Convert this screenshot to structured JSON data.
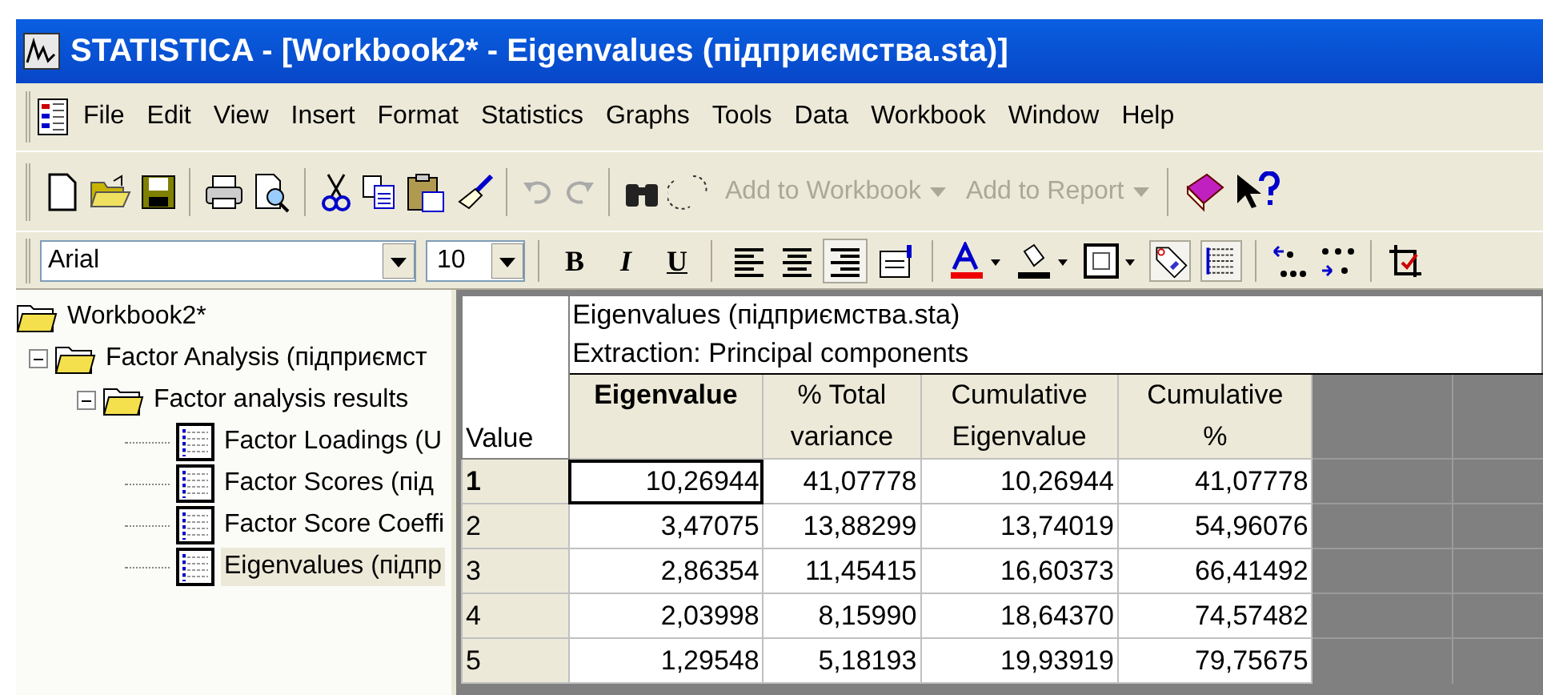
{
  "window": {
    "title": "STATISTICA - [Workbook2* - Eigenvalues (підприємства.sta)]"
  },
  "menu": [
    {
      "label": "File"
    },
    {
      "label": "Edit"
    },
    {
      "label": "View"
    },
    {
      "label": "Insert"
    },
    {
      "label": "Format"
    },
    {
      "label": "Statistics"
    },
    {
      "label": "Graphs"
    },
    {
      "label": "Tools"
    },
    {
      "label": "Data"
    },
    {
      "label": "Workbook"
    },
    {
      "label": "Window"
    },
    {
      "label": "Help"
    }
  ],
  "toolbar": {
    "text_buttons": [
      {
        "label": "Add to Workbook",
        "disabled": true
      },
      {
        "label": "Add to Report",
        "disabled": true
      }
    ]
  },
  "format_toolbar": {
    "font": "Arial",
    "size": "10",
    "style_buttons": [
      "B",
      "I",
      "U"
    ],
    "align_buttons": [
      {
        "selected": false
      },
      {
        "selected": false
      },
      {
        "selected": true
      }
    ]
  },
  "tree": [
    {
      "label": "Workbook2*",
      "selected": false,
      "children": [
        {
          "label": "Factor Analysis (підприємст",
          "expanded": true,
          "selected": false,
          "children": [
            {
              "label": "Factor analysis results",
              "expanded": true,
              "selected": false,
              "children": [
                {
                  "label": "Factor Loadings (U",
                  "selected": false
                },
                {
                  "label": "Factor Scores (під",
                  "selected": false
                },
                {
                  "label": "Factor Score Coeffi",
                  "selected": false
                },
                {
                  "label": "Eigenvalues (підпр",
                  "selected": true
                }
              ]
            }
          ]
        }
      ]
    }
  ],
  "table": {
    "header_lines": [
      "Eigenvalues (підприємства.sta)",
      "Extraction: Principal components"
    ],
    "row_header_label": "Value",
    "columns": [
      {
        "lines": [
          "Eigenvalue"
        ],
        "bold": true
      },
      {
        "lines": [
          "% Total",
          "variance"
        ],
        "bold": false
      },
      {
        "lines": [
          "Cumulative",
          "Eigenvalue"
        ],
        "bold": false
      },
      {
        "lines": [
          "Cumulative",
          "%"
        ],
        "bold": false
      }
    ],
    "rows": [
      {
        "label": "1",
        "selected": true,
        "cells": [
          "10,26944",
          "41,07778",
          "10,26944",
          "41,07778"
        ]
      },
      {
        "label": "2",
        "selected": false,
        "cells": [
          "3,47075",
          "13,88299",
          "13,74019",
          "54,96076"
        ]
      },
      {
        "label": "3",
        "selected": false,
        "cells": [
          "2,86354",
          "11,45415",
          "16,60373",
          "66,41492"
        ]
      },
      {
        "label": "4",
        "selected": false,
        "cells": [
          "2,03998",
          "8,15990",
          "18,64370",
          "74,57482"
        ]
      },
      {
        "label": "5",
        "selected": false,
        "cells": [
          "1,29548",
          "5,18193",
          "19,93919",
          "79,75675"
        ]
      }
    ]
  }
}
